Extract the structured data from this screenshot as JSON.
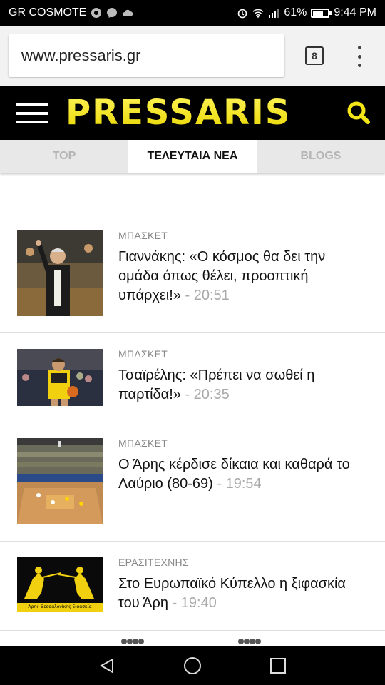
{
  "status_bar": {
    "carrier": "GR COSMOTE",
    "battery_percent": "61%",
    "battery_level": 0.61,
    "time": "9:44 PM"
  },
  "browser": {
    "url": "www.pressaris.gr",
    "tab_count": "8"
  },
  "site": {
    "logo": "PRESSARIS",
    "brand_color": "#f4e516"
  },
  "tabs": [
    {
      "label": "TOP",
      "active": false
    },
    {
      "label": "ΤΕΛΕΥΤΑΙΑ ΝΕΑ",
      "active": true
    },
    {
      "label": "BLOGS",
      "active": false
    }
  ],
  "articles": [
    {
      "category": "ΜΠΑΣΚΕΤ",
      "title": "Γιαννάκης: «Ο κόσμος θα δει την ομάδα όπως θέλει, προοπτική υπάρχει!»",
      "time": "- 20:51"
    },
    {
      "category": "ΜΠΑΣΚΕΤ",
      "title": "Τσαϊρέλης: «Πρέπει να σωθεί η παρτίδα!»",
      "time": "- 20:35"
    },
    {
      "category": "ΜΠΑΣΚΕΤ",
      "title": "Ο Άρης κέρδισε δίκαια και καθαρά το Λαύριο (80-69)",
      "time": "- 19:54"
    },
    {
      "category": "ΕΡΑΣΙΤΕΧΝΗΣ",
      "title": "Στο Ευρωπαϊκό Κύπελλο η ξιφασκία του Άρη",
      "time": "- 19:40",
      "thumb_caption": "Άρης Θεσσαλονίκης Ξιφασκία"
    }
  ],
  "icons": {
    "search": "search-icon",
    "menu": "hamburger-icon",
    "back": "back-triangle-icon",
    "home": "home-circle-icon",
    "recents": "recents-square-icon"
  }
}
